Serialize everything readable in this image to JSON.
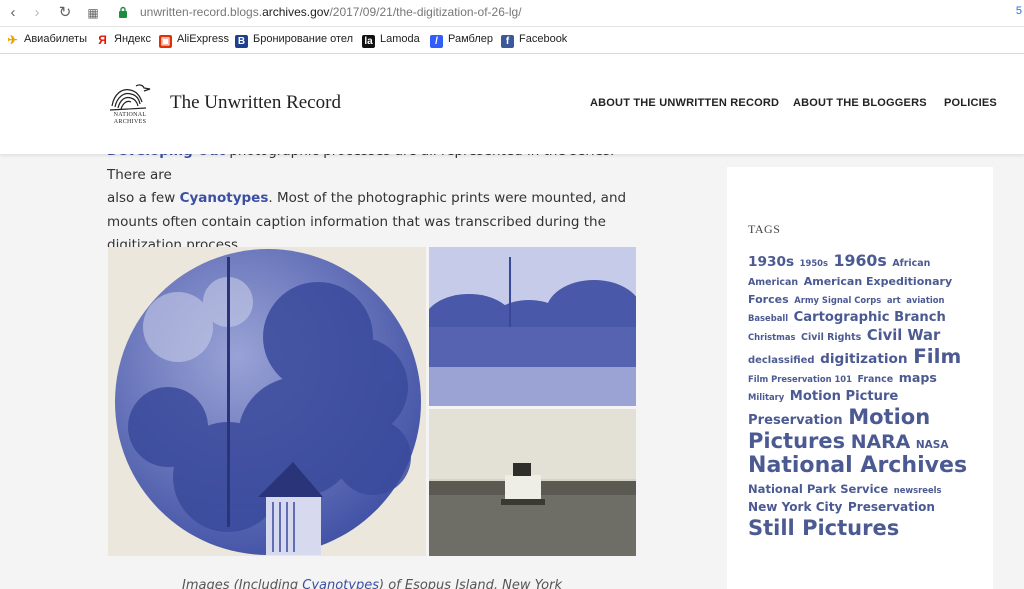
{
  "browser": {
    "url_prefix": "unwritten-record.blogs.",
    "url_domain": "archives.gov",
    "url_path": "/2017/09/21/the-digitization-of-26-lg/",
    "url_end": "5",
    "bookmarks": [
      {
        "label": "Авиабилеты",
        "icon": "plane-icon",
        "color": "#e8a200"
      },
      {
        "label": "Яндекс",
        "icon": "yandex-icon",
        "color": "#e61400"
      },
      {
        "label": "AliExpress",
        "icon": "aliexpress-icon",
        "color": "#e62e04"
      },
      {
        "label": "Бронирование отел",
        "icon": "booking-icon",
        "color": "#1f3f8f"
      },
      {
        "label": "Lamoda",
        "icon": "lamoda-icon",
        "color": "#111111"
      },
      {
        "label": "Рамблер",
        "icon": "rambler-icon",
        "color": "#315efb"
      },
      {
        "label": "Facebook",
        "icon": "facebook-icon",
        "color": "#3b5998"
      }
    ]
  },
  "header": {
    "logo_line1": "NATIONAL",
    "logo_line2": "ARCHIVES",
    "site_title": "The Unwritten Record",
    "nav": [
      "ABOUT THE UNWRITTEN RECORD",
      "ABOUT THE BLOGGERS",
      "POLICIES"
    ]
  },
  "article": {
    "line1_link": "Developing Out",
    "line1_text": " photographic processes are all represented in the series. There are",
    "line2_text_a": "also a few ",
    "line2_link": "Cyanotypes",
    "line2_text_b": ". Most of the photographic prints were mounted, and",
    "line3_text": "mounts often contain caption information that was transcribed during the",
    "line4_text": "digitization process.",
    "caption_a": "Images (Including ",
    "caption_link": "Cyanotypes",
    "caption_b": ") of Esopus Island, New York"
  },
  "sidebar": {
    "heading": "TAGS",
    "tags": [
      {
        "t": "1930s",
        "s": 13
      },
      {
        "t": "1950s",
        "s": 8
      },
      {
        "t": "1960s",
        "s": 15
      },
      {
        "t": "African American",
        "s": 9
      },
      {
        "t": "American Expeditionary Forces",
        "s": 10.5
      },
      {
        "t": "Army Signal Corps",
        "s": 8
      },
      {
        "t": "art",
        "s": 8
      },
      {
        "t": "aviation",
        "s": 8
      },
      {
        "t": "Baseball",
        "s": 8
      },
      {
        "t": "Cartographic Branch",
        "s": 12.5
      },
      {
        "t": "Christmas",
        "s": 8
      },
      {
        "t": "Civil Rights",
        "s": 9
      },
      {
        "t": "Civil War",
        "s": 14
      },
      {
        "t": "declassified",
        "s": 9.5
      },
      {
        "t": "digitization",
        "s": 13
      },
      {
        "t": "Film",
        "s": 19
      },
      {
        "t": "Film Preservation 101",
        "s": 8
      },
      {
        "t": "France",
        "s": 9
      },
      {
        "t": "maps",
        "s": 12
      },
      {
        "t": "Military",
        "s": 8
      },
      {
        "t": "Motion Picture Preservation",
        "s": 12.5
      },
      {
        "t": "Motion Pictures",
        "s": 20
      },
      {
        "t": "NARA",
        "s": 18
      },
      {
        "t": "NASA",
        "s": 10
      },
      {
        "t": "National Archives",
        "s": 21
      },
      {
        "t": "National Park Service",
        "s": 11
      },
      {
        "t": "newsreels",
        "s": 8
      },
      {
        "t": "New York City",
        "s": 11.5
      },
      {
        "t": "Preservation",
        "s": 11.5
      },
      {
        "t": "Still Pictures",
        "s": 20
      }
    ]
  }
}
